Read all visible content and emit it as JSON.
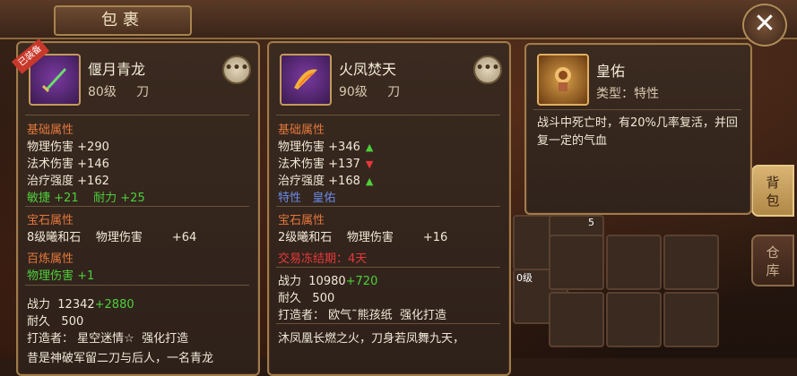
{
  "window": {
    "title": "包裹"
  },
  "tabs": {
    "bag": "背包",
    "store": "仓库"
  },
  "item1": {
    "tag": "已装备",
    "name": "偃月青龙",
    "level": "80级",
    "type": "刀",
    "basic_header": "基础属性",
    "stats": [
      {
        "label": "物理伤害",
        "value": "+290"
      },
      {
        "label": "法术伤害",
        "value": "+146"
      },
      {
        "label": "治疗强度",
        "value": "+162"
      }
    ],
    "bonus1_label": "敏捷",
    "bonus1_value": "+21",
    "bonus2_label": "耐力",
    "bonus2_value": "+25",
    "gem_header": "宝石属性",
    "gem_text": "8级曦和石",
    "gem_stat": "物理伤害",
    "gem_value": "+64",
    "refine_header": "百炼属性",
    "refine_stat": "物理伤害",
    "refine_value": "+1",
    "power_label": "战力",
    "power_value": "12342",
    "power_bonus": "+2880",
    "durability_label": "耐久",
    "durability_value": "500",
    "maker_label": "打造者：",
    "maker_value": "星空迷情☆",
    "forge_label": "强化打造",
    "lore": "昔是神破军留二刀与后人，一名青龙"
  },
  "item2": {
    "name": "火凤焚天",
    "level": "90级",
    "type": "刀",
    "basic_header": "基础属性",
    "stats": [
      {
        "label": "物理伤害",
        "value": "+346",
        "trend": "up"
      },
      {
        "label": "法术伤害",
        "value": "+137",
        "trend": "down"
      },
      {
        "label": "治疗强度",
        "value": "+168",
        "trend": "up"
      }
    ],
    "special_label": "特性",
    "special_value": "皇佑",
    "gem_header": "宝石属性",
    "gem_text": "2级曦和石",
    "gem_stat": "物理伤害",
    "gem_value": "+16",
    "freeze_text": "交易冻结期：4天",
    "power_label": "战力",
    "power_value": "10980",
    "power_bonus": "+720",
    "durability_label": "耐久",
    "durability_value": "500",
    "maker_label": "打造者：",
    "maker_value": "欧气˜熊孩纸",
    "forge_label": "强化打造",
    "lore": "沐凤凰长燃之火，刀身若凤舞九天，"
  },
  "tooltip": {
    "name": "皇佑",
    "type_label": "类型：特性",
    "desc": "战斗中死亡时，有20%几率复活，并回复一定的气血"
  },
  "grid": {
    "slot_count_a": "5",
    "slot_count_b": "0级"
  },
  "icons": {
    "close": "close-icon",
    "more": "more-icon",
    "up": "arrow-up-icon",
    "down": "arrow-down-icon"
  }
}
